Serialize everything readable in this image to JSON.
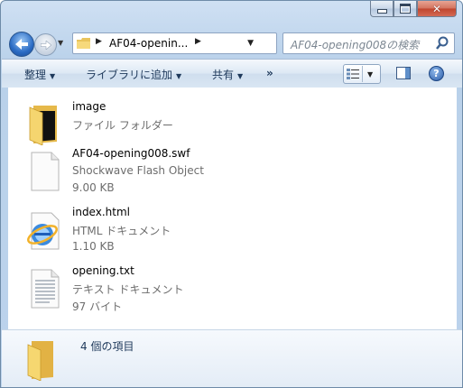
{
  "window": {
    "caption_buttons": [
      "minimize",
      "maximize",
      "close"
    ]
  },
  "navigation": {
    "address_crumb": "AF04-openin...",
    "search_placeholder": "AF04-opening008の検索"
  },
  "toolbar": {
    "organize": "整理",
    "add_to_library": "ライブラリに追加",
    "share": "共有",
    "more": "»"
  },
  "files": [
    {
      "name": "image",
      "type": "ファイル フォルダー",
      "size": "",
      "icon": "folder-icon"
    },
    {
      "name": "AF04-opening008.swf",
      "type": "Shockwave Flash Object",
      "size": "9.00 KB",
      "icon": "blank-file-icon"
    },
    {
      "name": "index.html",
      "type": "HTML ドキュメント",
      "size": "1.10 KB",
      "icon": "internet-explorer-icon"
    },
    {
      "name": "opening.txt",
      "type": "テキスト ドキュメント",
      "size": "97 バイト",
      "icon": "text-file-icon"
    }
  ],
  "details": {
    "item_count": "4 個の項目"
  }
}
